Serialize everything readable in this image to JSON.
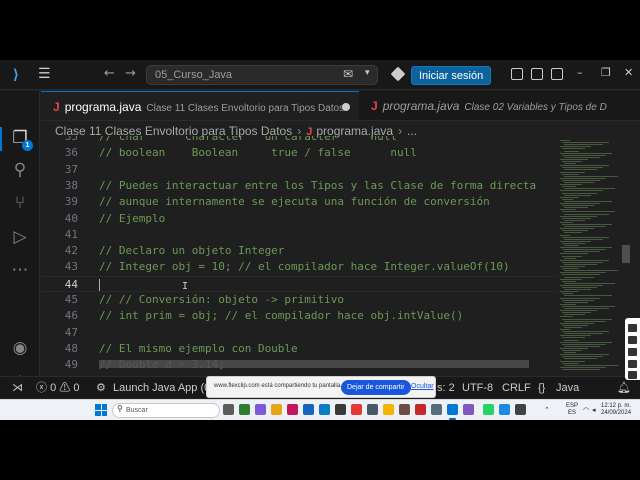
{
  "titlebar": {
    "search_text": "05_Curso_Java",
    "signin_label": "Iniciar sesión"
  },
  "activitybar": {
    "explorer_badge": "1"
  },
  "tabs": [
    {
      "name": "programa.java",
      "desc": "Clase 11 Clases Envoltorio para Tipos Datos",
      "active": true,
      "unsaved": true
    },
    {
      "name": "programa.java",
      "desc": "Clase 02 Variables y Tipos de D",
      "active": false
    }
  ],
  "breadcrumb": {
    "folder": "Clase 11 Clases Envoltorio para Tipos Datos",
    "file": "programa.java",
    "more": "..."
  },
  "editor": {
    "current_line": 44,
    "lines": [
      {
        "n": "35",
        "t": "// char      Character   un caracter     null"
      },
      {
        "n": "36",
        "t": "// boolean    Boolean     true / false      null"
      },
      {
        "n": "37",
        "t": ""
      },
      {
        "n": "38",
        "t": "// Puedes interactuar entre los Tipos y las Clase de forma directa"
      },
      {
        "n": "39",
        "t": "// aunque internamente se ejecuta una función de conversión"
      },
      {
        "n": "40",
        "t": "// Ejemplo"
      },
      {
        "n": "41",
        "t": ""
      },
      {
        "n": "42",
        "t": "// Declaro un objeto Integer"
      },
      {
        "n": "43",
        "t": "// Integer obj = 10; // el compilador hace Integer.valueOf(10)"
      },
      {
        "n": "44",
        "t": ""
      },
      {
        "n": "45",
        "t": "// // Conversión: objeto -> primitivo"
      },
      {
        "n": "46",
        "t": "// int prim = obj; // el compilador hace obj.intValue()"
      },
      {
        "n": "47",
        "t": ""
      },
      {
        "n": "48",
        "t": "// El mismo ejemplo con Double"
      },
      {
        "n": "49",
        "t": "// Double d = 3.14;"
      }
    ]
  },
  "statusbar": {
    "errors": "0",
    "warnings": "0",
    "launch": "Launch Java App (05",
    "spaces": "s: 2",
    "encoding": "UTF-8",
    "eol": "CRLF",
    "language": "Java"
  },
  "share_banner": {
    "text": "www.flexclip.com está compartiendo tu pantalla.",
    "stop_label": "Dejar de compartir",
    "hide_label": "Ocultar"
  },
  "taskbar": {
    "search_label": "Buscar",
    "lang": "ESP",
    "region": "ES",
    "time": "12:12 p. m.",
    "date": "24/09/2024"
  },
  "colors": {
    "editor_bg": "#1f1f1f",
    "comment": "#6a9955",
    "accent": "#0078d4",
    "signin_bg": "#0e639c",
    "java_icon": "#e04848"
  },
  "icons": [
    "vscode-logo-icon",
    "menu-icon",
    "back-arrow-icon",
    "forward-arrow-icon",
    "chat-icon",
    "copilot-icon",
    "layout-icon",
    "minimize-icon",
    "restore-icon",
    "close-icon",
    "files-icon",
    "search-icon",
    "source-control-icon",
    "run-debug-icon",
    "extensions-icon",
    "account-icon",
    "settings-gear-icon",
    "remote-icon",
    "error-icon",
    "warning-icon",
    "braces-icon",
    "bell-icon",
    "windows-start-icon"
  ]
}
